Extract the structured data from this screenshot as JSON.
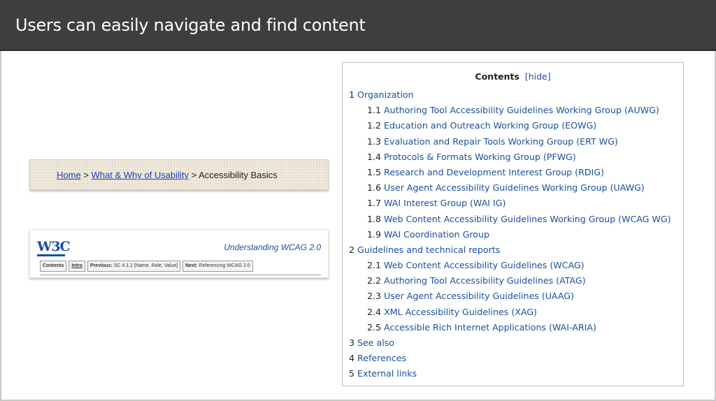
{
  "slide": {
    "title": "Users can easily navigate and find content"
  },
  "breadcrumb": {
    "home": "Home",
    "sep1": ">",
    "section": "What & Why of Usability",
    "sep2": ">",
    "current": "Accessibility Basics"
  },
  "w3c": {
    "logo_text": "W3C",
    "subtitle": "Understanding WCAG 2.0",
    "nav": [
      {
        "label": "Contents",
        "bold": true
      },
      {
        "label": "Intro"
      },
      {
        "prefix": "Previous:",
        "label": "SC 4.1.2 [Name, Role, Value]"
      },
      {
        "prefix": "Next:",
        "label": "Referencing WCAG 2.0"
      }
    ]
  },
  "toc": {
    "title": "Contents",
    "hide_link": "[hide]",
    "items": [
      {
        "num": "1",
        "text": "Organization",
        "level": 1
      },
      {
        "num": "1.1",
        "text": "Authoring Tool Accessibility Guidelines Working Group (AUWG)",
        "level": 2
      },
      {
        "num": "1.2",
        "text": "Education and Outreach Working Group (EOWG)",
        "level": 2
      },
      {
        "num": "1.3",
        "text": "Evaluation and Repair Tools Working Group (ERT WG)",
        "level": 2
      },
      {
        "num": "1.4",
        "text": "Protocols & Formats Working Group (PFWG)",
        "level": 2
      },
      {
        "num": "1.5",
        "text": "Research and Development Interest Group (RDIG)",
        "level": 2
      },
      {
        "num": "1.6",
        "text": "User Agent Accessibility Guidelines Working Group (UAWG)",
        "level": 2
      },
      {
        "num": "1.7",
        "text": "WAI Interest Group (WAI IG)",
        "level": 2
      },
      {
        "num": "1.8",
        "text": "Web Content Accessibility Guidelines Working Group (WCAG WG)",
        "level": 2
      },
      {
        "num": "1.9",
        "text": "WAI Coordination Group",
        "level": 2
      },
      {
        "num": "2",
        "text": "Guidelines and technical reports",
        "level": 1
      },
      {
        "num": "2.1",
        "text": "Web Content Accessibility Guidelines (WCAG)",
        "level": 2
      },
      {
        "num": "2.2",
        "text": "Authoring Tool Accessibility Guidelines (ATAG)",
        "level": 2
      },
      {
        "num": "2.3",
        "text": "User Agent Accessibility Guidelines (UAAG)",
        "level": 2
      },
      {
        "num": "2.4",
        "text": "XML Accessibility Guidelines (XAG)",
        "level": 2
      },
      {
        "num": "2.5",
        "text": "Accessible Rich Internet Applications (WAI-ARIA)",
        "level": 2
      },
      {
        "num": "3",
        "text": "See also",
        "level": 1
      },
      {
        "num": "4",
        "text": "References",
        "level": 1
      },
      {
        "num": "5",
        "text": "External links",
        "level": 1
      }
    ]
  },
  "colors": {
    "header_bg": "#3e3e3e",
    "link": "#1a4f9a",
    "breadcrumb_link": "#1f3fbf"
  }
}
